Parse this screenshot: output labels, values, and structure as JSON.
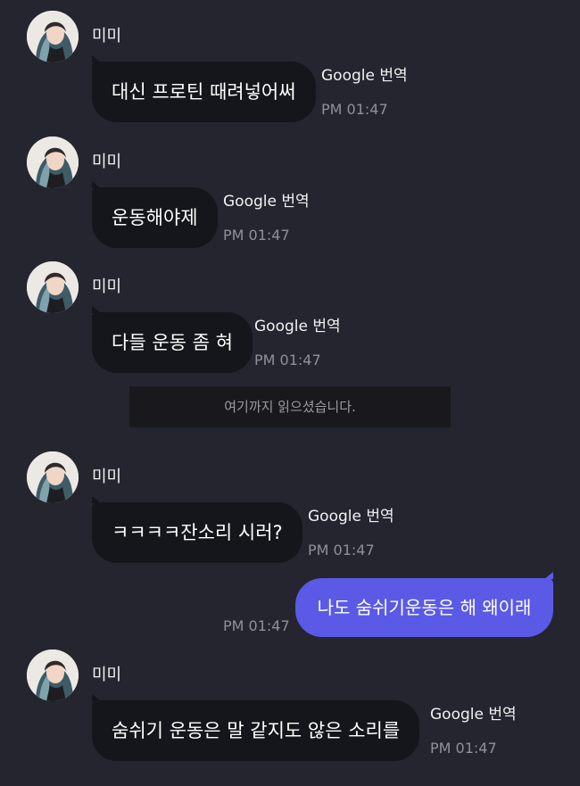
{
  "colors": {
    "background": "#24252e",
    "bubble_in": "#15161b",
    "bubble_out": "#5a5ae6",
    "timestamp": "#8f909c"
  },
  "messages": [
    {
      "sender": "미미",
      "text": "대신 프로틴 때려넣어써",
      "translate": "Google 번역",
      "time": "PM 01:47"
    },
    {
      "sender": "미미",
      "text": "운동해야제",
      "translate": "Google 번역",
      "time": "PM 01:47"
    },
    {
      "sender": "미미",
      "text": "다들 운동 좀 혀",
      "translate": "Google 번역",
      "time": "PM 01:47"
    },
    {
      "sender": "미미",
      "text": "ㅋㅋㅋㅋ잔소리 시러?",
      "translate": "Google 번역",
      "time": "PM 01:47"
    },
    {
      "sender": "미미",
      "text": "숨쉬기 운동은 말 같지도 않은 소리를",
      "translate": "Google 번역",
      "time": "PM 01:47"
    }
  ],
  "read_marker": "여기까지 읽으셨습니다.",
  "my_message": {
    "text": "나도 숨쉬기운동은 해 왜이래",
    "time": "PM 01:47"
  }
}
